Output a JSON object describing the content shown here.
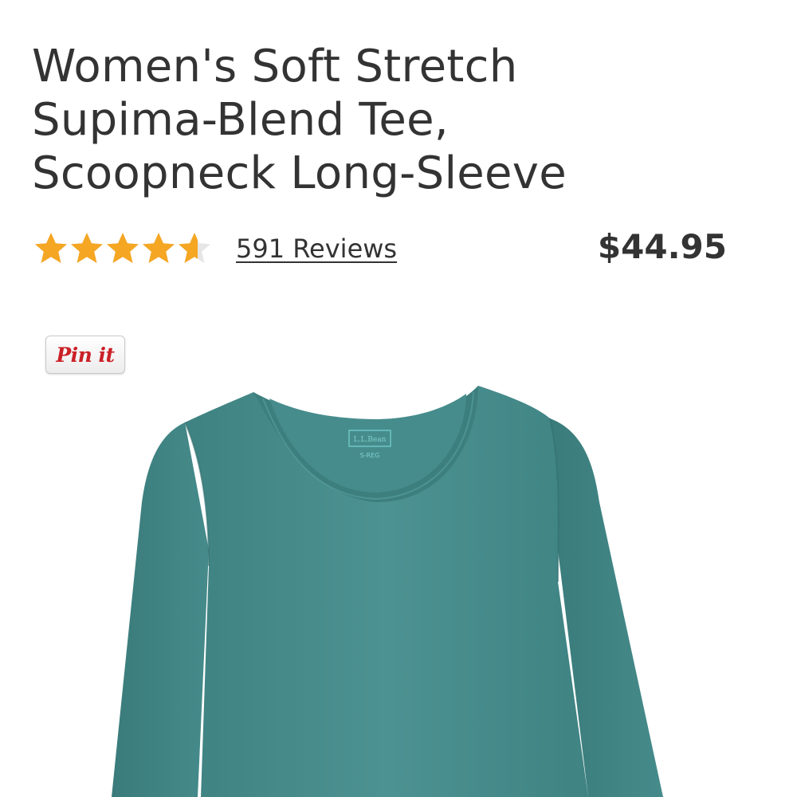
{
  "product": {
    "title_lines": [
      "Women's Soft Stretch",
      "Supima-Blend Tee,",
      "Scoopneck Long-Sleeve"
    ],
    "rating": 4.6,
    "rating_max": 5,
    "reviews_label": "591 Reviews",
    "price": "$44.95",
    "image_alt": "Teal long-sleeve scoopneck tee",
    "tag_brand": "L.L.Bean",
    "tag_size": "S-REG"
  },
  "pin_button": {
    "label": "Pin it"
  },
  "colors": {
    "text": "#333333",
    "star_filled": "#f5a623",
    "star_empty": "#e6e6e6",
    "shirt": "#4a8f8f",
    "pin_red": "#cb2027"
  },
  "icons": {
    "rating_star": "star-icon"
  }
}
